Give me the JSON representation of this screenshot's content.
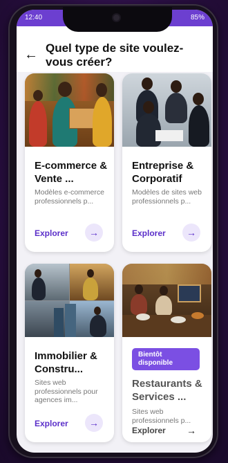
{
  "status": {
    "time": "12:40",
    "right": "85%"
  },
  "header": {
    "back_icon": "arrow-left-icon",
    "title": "Quel type de site voulez-vous créer?"
  },
  "cards": [
    {
      "name": "E-commerce & Vente ...",
      "desc": "Modèles e-commerce professionnels p...",
      "explore": "Explorer"
    },
    {
      "name": "Entreprise & Corporatif",
      "desc": "Modèles de sites web professionnels p...",
      "explore": "Explorer"
    },
    {
      "name": "Immobilier & Constru...",
      "desc": "Sites web professionnels pour agences im...",
      "explore": "Explorer"
    },
    {
      "name": "Restaurants & Services ...",
      "desc": "Sites web professionnels p...",
      "explore": "Explorer",
      "badge": "Bientôt disponible"
    }
  ],
  "colors": {
    "accent": "#5b2fc9",
    "badge": "#7b4fe3",
    "statusbar": "#6c3fd0"
  }
}
